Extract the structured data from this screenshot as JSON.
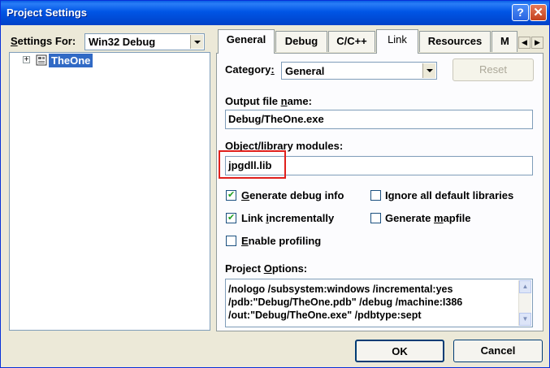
{
  "window": {
    "title": "Project Settings"
  },
  "settings_for": {
    "label_u": "S",
    "label_rest": "ettings For:",
    "value": "Win32 Debug"
  },
  "tree": {
    "root_label": "TheOne",
    "expander": "+"
  },
  "tabs": [
    {
      "label": "General"
    },
    {
      "label": "Debug"
    },
    {
      "label": "C/C++"
    },
    {
      "label": "Link"
    },
    {
      "label": "Resources"
    },
    {
      "label": "M"
    }
  ],
  "link": {
    "category": {
      "label_a": "Category",
      "label_u": ":",
      "value": "General"
    },
    "reset_label": "Reset",
    "output_file": {
      "label_a": "Output file ",
      "label_u": "n",
      "label_b": "ame:",
      "value": "Debug/TheOne.exe"
    },
    "object_modules": {
      "label_a": "Object/library modules:",
      "value": "jpgdll.lib"
    },
    "checkboxes": {
      "generate_debug": {
        "label_u": "G",
        "label_rest": "enerate debug info",
        "checked": true
      },
      "ignore_libraries": {
        "label_a": "Ignore all default libraries",
        "checked": false
      },
      "link_incrementally": {
        "label_a": "Link ",
        "label_u": "i",
        "label_b": "ncrementally",
        "checked": true
      },
      "generate_mapfile": {
        "label_a": "Generate ",
        "label_u": "m",
        "label_b": "apfile",
        "checked": false
      },
      "enable_profiling": {
        "label_u": "E",
        "label_rest": "nable profiling",
        "checked": false
      }
    },
    "project_options": {
      "label_a": "Project ",
      "label_u": "O",
      "label_b": "ptions:",
      "lines": [
        "/nologo /subsystem:windows /incremental:yes",
        "/pdb:\"Debug/TheOne.pdb\" /debug /machine:I386",
        "/out:\"Debug/TheOne.exe\" /pdbtype:sept"
      ]
    }
  },
  "footer": {
    "ok_label": "OK",
    "cancel_label": "Cancel"
  },
  "colors": {
    "titlebar": "#0055e5",
    "highlight": "#e0201c",
    "tree_selected": "#316ac5"
  }
}
